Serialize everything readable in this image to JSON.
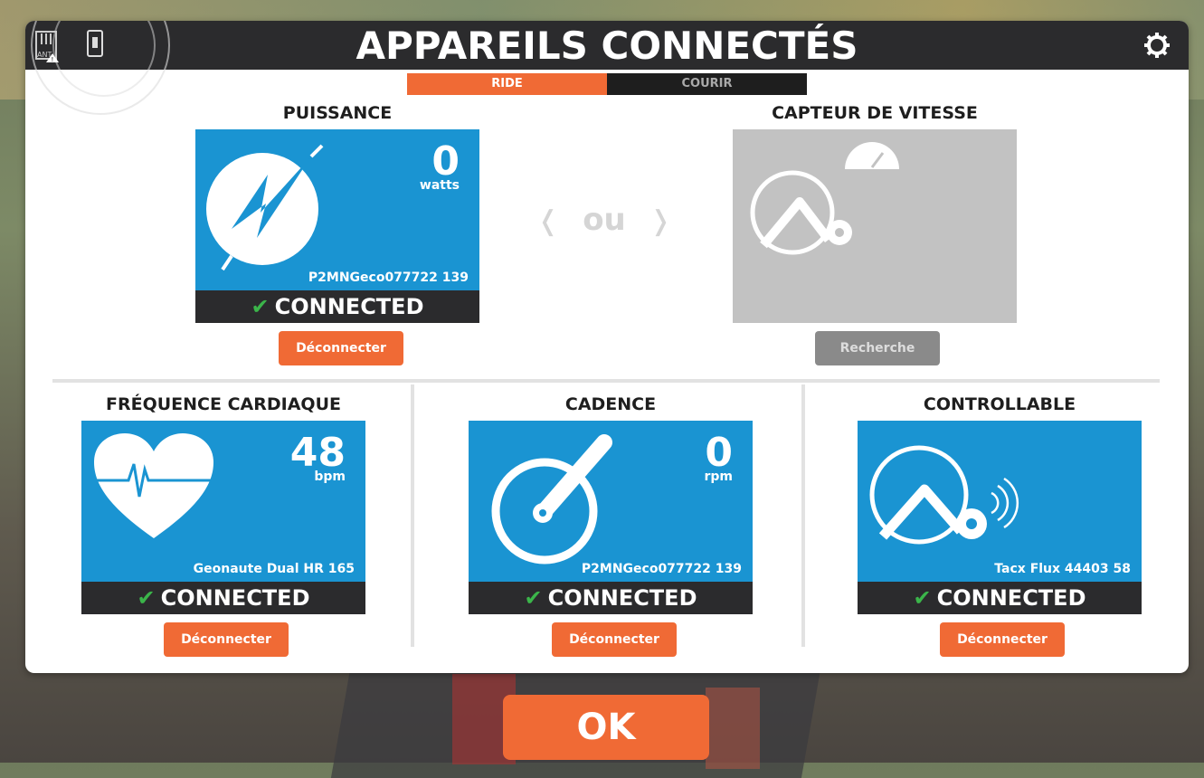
{
  "header": {
    "title": "APPAREILS CONNECTÉS",
    "ant_label": "ANT",
    "icons": [
      "ant-icon",
      "phone-bluetooth-icon",
      "gear-icon"
    ]
  },
  "tabs": [
    {
      "label": "RIDE",
      "active": true
    },
    {
      "label": "COURIR",
      "active": false
    }
  ],
  "separator_text": "ou",
  "sections": {
    "power": {
      "title": "PUISSANCE",
      "value": "0",
      "unit": "watts",
      "device": "P2MNGeco077722 139",
      "status": "CONNECTED",
      "button": "Déconnecter",
      "icon": "power-bolt-icon"
    },
    "speed": {
      "title": "CAPTEUR DE VITESSE",
      "button": "Recherche",
      "icon": "speed-sensor-icon"
    },
    "heart": {
      "title": "FRÉQUENCE CARDIAQUE",
      "value": "48",
      "unit": "bpm",
      "device": "Geonaute Dual HR 165",
      "status": "CONNECTED",
      "button": "Déconnecter",
      "icon": "heart-rate-icon"
    },
    "cadence": {
      "title": "CADENCE",
      "value": "0",
      "unit": "rpm",
      "device": "P2MNGeco077722 139",
      "status": "CONNECTED",
      "button": "Déconnecter",
      "icon": "crank-icon"
    },
    "trainer": {
      "title": "CONTROLLABLE",
      "device": "Tacx Flux 44403 58",
      "status": "CONNECTED",
      "button": "Déconnecter",
      "icon": "smart-trainer-icon"
    }
  },
  "ok_label": "OK",
  "colors": {
    "accent": "#f06a35",
    "card_blue": "#1a94d2",
    "dark": "#2b2b2d",
    "check_green": "#3bb54a",
    "inactive_gray": "#c2c2c2"
  }
}
